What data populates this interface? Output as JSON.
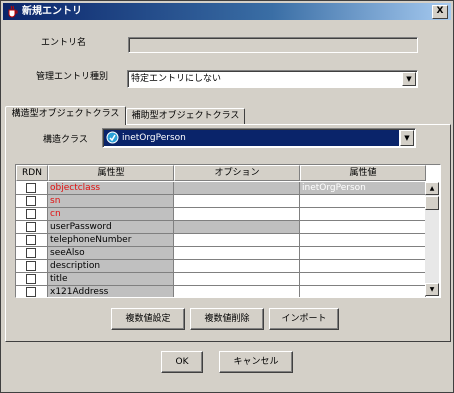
{
  "window": {
    "title": "新規エントリ",
    "close_glyph": "X"
  },
  "form": {
    "entry_name_label": "エントリ名",
    "entry_name_value": "",
    "mgmt_type_label": "管理エントリ種別",
    "mgmt_type_value": "特定エントリにしない",
    "struct_class_label": "構造クラス",
    "struct_class_value": "inetOrgPerson"
  },
  "tabs": [
    {
      "label": "構造型オブジェクトクラス",
      "active": true
    },
    {
      "label": "補助型オブジェクトクラス",
      "active": false
    }
  ],
  "table": {
    "headers": [
      "RDN",
      "属性型",
      "オプション",
      "属性値"
    ],
    "rows": [
      {
        "attr": "objectclass",
        "value": "inetOrgPerson",
        "required": true
      },
      {
        "attr": "sn",
        "value": "",
        "required": true
      },
      {
        "attr": "cn",
        "value": "",
        "required": true
      },
      {
        "attr": "userPassword",
        "value": "",
        "required": false
      },
      {
        "attr": "telephoneNumber",
        "value": "",
        "required": false
      },
      {
        "attr": "seeAlso",
        "value": "",
        "required": false
      },
      {
        "attr": "description",
        "value": "",
        "required": false
      },
      {
        "attr": "title",
        "value": "",
        "required": false
      },
      {
        "attr": "x121Address",
        "value": "",
        "required": false
      }
    ]
  },
  "buttons": {
    "multi_set": "複数値設定",
    "multi_delete": "複数値削除",
    "import": "インポート",
    "ok": "OK",
    "cancel": "キャンセル"
  },
  "colors": {
    "required_text": "#e01010",
    "title_bar": "#0a246a",
    "selection": "#0a246a"
  }
}
